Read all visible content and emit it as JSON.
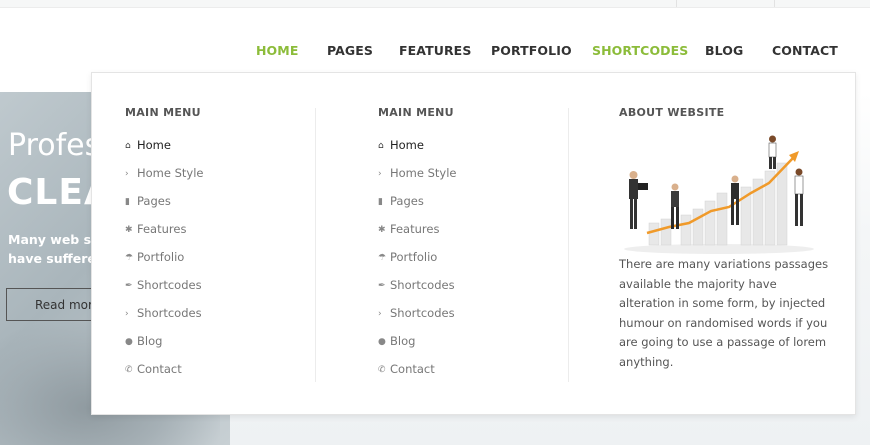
{
  "nav": {
    "items": [
      {
        "label": "HOME",
        "active": true
      },
      {
        "label": "PAGES",
        "active": false
      },
      {
        "label": "FEATURES",
        "active": false
      },
      {
        "label": "PORTFOLIO",
        "active": false
      },
      {
        "label": "SHORTCODES",
        "active": true
      },
      {
        "label": "BLOG",
        "active": false
      },
      {
        "label": "CONTACT",
        "active": false
      }
    ],
    "accent_color": "#8cbc3a"
  },
  "hero": {
    "title_line1": "Profes",
    "title_line2": "CLEA",
    "text_line1": "Many web sites",
    "text_line2": "have suffered a",
    "button_label": "Read more"
  },
  "mega_menu": {
    "columns": [
      {
        "title": "MAIN MENU",
        "items": [
          {
            "label": "Home",
            "icon": "home-icon"
          },
          {
            "label": "Home Style",
            "icon": "chevron-right-icon"
          },
          {
            "label": "Pages",
            "icon": "document-icon"
          },
          {
            "label": "Features",
            "icon": "gear-icon"
          },
          {
            "label": "Portfolio",
            "icon": "umbrella-icon"
          },
          {
            "label": "Shortcodes",
            "icon": "wrench-icon"
          },
          {
            "label": "Shortcodes",
            "icon": "chevron-right-icon"
          },
          {
            "label": "Blog",
            "icon": "comment-icon"
          },
          {
            "label": "Contact",
            "icon": "phone-icon"
          }
        ]
      },
      {
        "title": "MAIN MENU",
        "items": [
          {
            "label": "Home",
            "icon": "home-icon"
          },
          {
            "label": "Home Style",
            "icon": "chevron-right-icon"
          },
          {
            "label": "Pages",
            "icon": "document-icon"
          },
          {
            "label": "Features",
            "icon": "gear-icon"
          },
          {
            "label": "Portfolio",
            "icon": "umbrella-icon"
          },
          {
            "label": "Shortcodes",
            "icon": "wrench-icon"
          },
          {
            "label": "Shortcodes",
            "icon": "chevron-right-icon"
          },
          {
            "label": "Blog",
            "icon": "comment-icon"
          },
          {
            "label": "Contact",
            "icon": "phone-icon"
          }
        ]
      }
    ],
    "about": {
      "title": "ABOUT WEBSITE",
      "text": "There are many variations passages available the majority have alteration in some form, by injected humour on randomised words if you are going to use a passage of lorem anything."
    }
  }
}
